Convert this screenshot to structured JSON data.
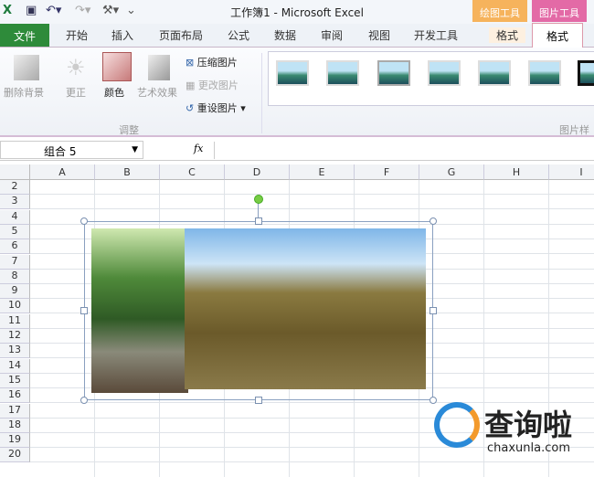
{
  "window": {
    "title": "工作簿1 - Microsoft Excel"
  },
  "context_tabs": [
    {
      "label": "绘图工具",
      "sub": "格式",
      "color": "#f39a2c"
    },
    {
      "label": "图片工具",
      "sub": "格式",
      "color": "#d9478f"
    }
  ],
  "tabs": [
    "文件",
    "开始",
    "插入",
    "页面布局",
    "公式",
    "数据",
    "审阅",
    "视图",
    "开发工具"
  ],
  "ribbon": {
    "remove_bg": "删除背景",
    "corrections": "更正",
    "color": "颜色",
    "artistic": "艺术效果",
    "compress": "压缩图片",
    "change": "更改图片",
    "reset": "重设图片",
    "group_adjust": "调整",
    "group_styles": "图片样"
  },
  "formula_bar": {
    "name_box": "组合 5",
    "fx": "fx",
    "value": ""
  },
  "columns": [
    "A",
    "B",
    "C",
    "D",
    "E",
    "F",
    "G",
    "H",
    "I"
  ],
  "rows": [
    "2",
    "3",
    "4",
    "5",
    "6",
    "7",
    "8",
    "9",
    "10",
    "11",
    "12",
    "13",
    "14",
    "15",
    "16",
    "17",
    "18",
    "19",
    "20"
  ],
  "watermark": {
    "text": "查询啦",
    "url": "chaxunla.com"
  }
}
